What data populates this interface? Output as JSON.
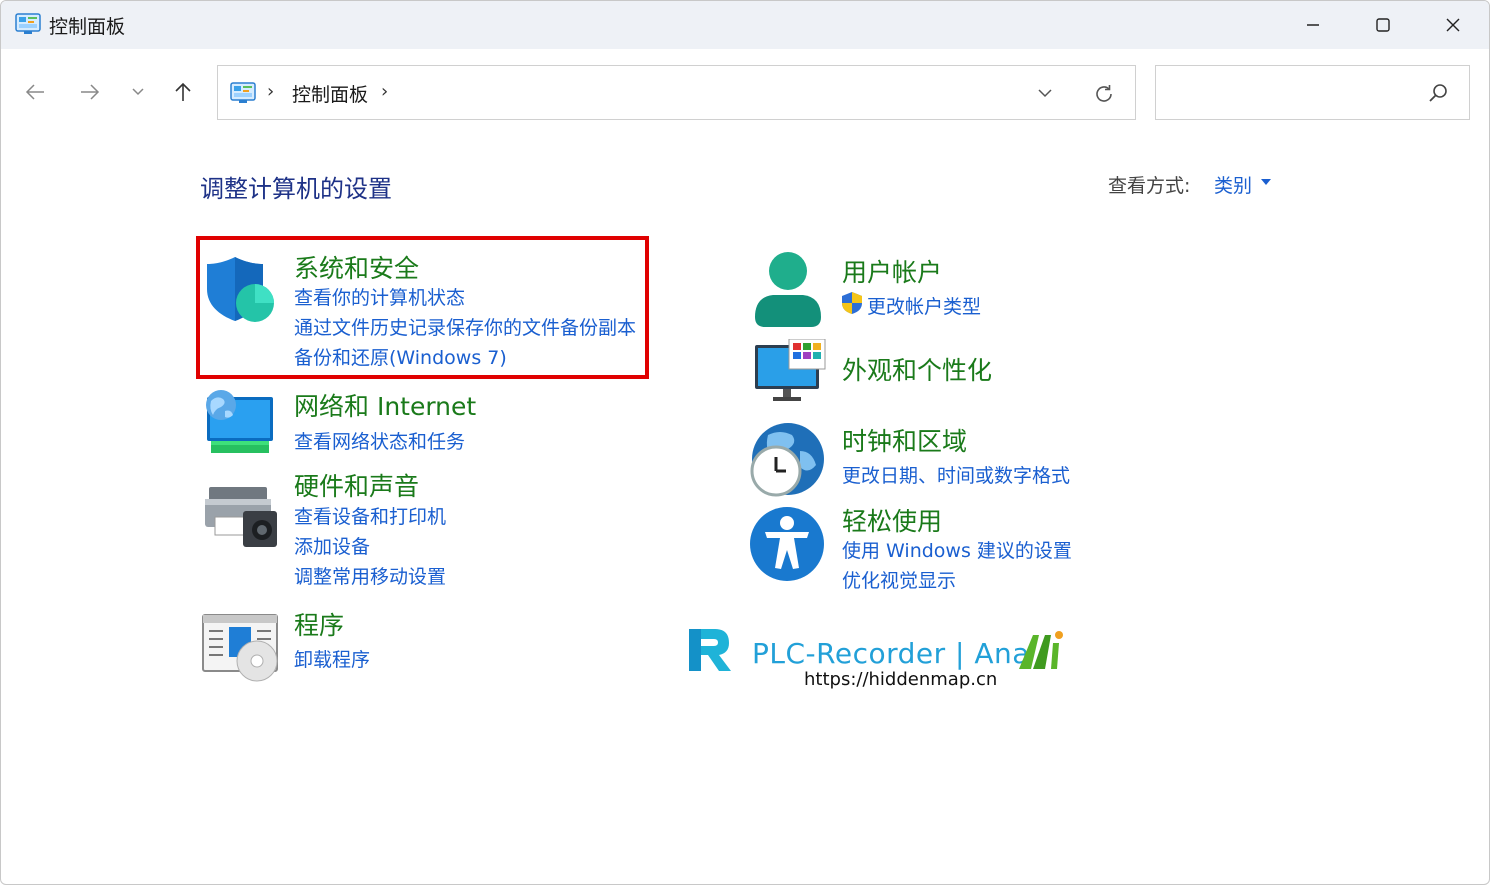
{
  "window": {
    "title": "控制面板",
    "minimize_symbol": "—",
    "maximize_symbol": "☐",
    "close_symbol": "✕"
  },
  "nav": {
    "back_icon": "arrow-left-icon",
    "forward_icon": "arrow-right-icon",
    "recent_icon": "chevron-down-icon",
    "up_icon": "arrow-up-icon"
  },
  "address": {
    "breadcrumb": "控制面板",
    "separator": "›"
  },
  "search": {
    "placeholder": ""
  },
  "header": {
    "page_title": "调整计算机的设置",
    "view_by_label": "查看方式:",
    "view_by_value": "类别"
  },
  "categories": {
    "system_security": {
      "title": "系统和安全",
      "links": [
        "查看你的计算机状态",
        "通过文件历史记录保存你的文件备份副本",
        "备份和还原(Windows 7)"
      ]
    },
    "network": {
      "title": "网络和 Internet",
      "links": [
        "查看网络状态和任务"
      ]
    },
    "hardware": {
      "title": "硬件和声音",
      "links": [
        "查看设备和打印机",
        "添加设备",
        "调整常用移动设置"
      ]
    },
    "programs": {
      "title": "程序",
      "links": [
        "卸载程序"
      ]
    },
    "user_accounts": {
      "title": "用户帐户",
      "links": [
        "更改帐户类型"
      ]
    },
    "appearance": {
      "title": "外观和个性化",
      "links": []
    },
    "clock_region": {
      "title": "时钟和区域",
      "links": [
        "更改日期、时间或数字格式"
      ]
    },
    "ease_of_access": {
      "title": "轻松使用",
      "links": [
        "使用 Windows 建议的设置",
        "优化视觉显示"
      ]
    }
  },
  "watermark": {
    "brand": "PLC-Recorder | Ana",
    "url": "https://hiddenmap.cn"
  },
  "colors": {
    "title_blue": "#1e3287",
    "link_blue": "#1a5fd0",
    "category_green": "#1a7a1a",
    "highlight_red": "#e00000"
  }
}
